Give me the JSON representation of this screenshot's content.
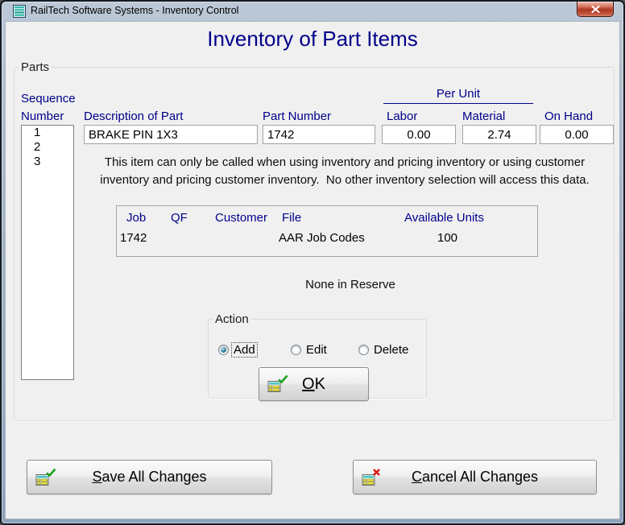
{
  "window": {
    "title": "RailTech Software Systems - Inventory Control"
  },
  "heading": "Inventory of Part Items",
  "parts": {
    "legend": "Parts",
    "labels": {
      "sequence": "Sequence",
      "number": "Number",
      "description": "Description of Part",
      "part_number": "Part Number",
      "per_unit": "Per Unit",
      "labor": "Labor",
      "material": "Material",
      "on_hand": "On Hand"
    },
    "sequence_list": [
      "1",
      "2",
      "3"
    ],
    "fields": {
      "description": "BRAKE PIN 1X3",
      "part_number": "1742",
      "labor": "0.00",
      "material": "2.74",
      "on_hand": "0.00"
    },
    "note_line1": "This item can only be called when using inventory and pricing inventory or using customer",
    "note_line2": "inventory and pricing customer inventory.  No other inventory selection will access this data.",
    "job_box": {
      "headers": {
        "job": "Job",
        "qf": "QF",
        "customer": "Customer",
        "file": "File",
        "available_units": "Available Units"
      },
      "values": {
        "job": "1742",
        "file": "AAR Job Codes",
        "available_units": "100"
      }
    },
    "reserve_text": "None in Reserve",
    "action": {
      "legend": "Action",
      "options": [
        {
          "label": "Add",
          "selected": true
        },
        {
          "label": "Edit",
          "selected": false
        },
        {
          "label": "Delete",
          "selected": false
        }
      ],
      "ok_label": "OK"
    }
  },
  "footer": {
    "save_label": "Save All Changes",
    "cancel_label": "Cancel All Changes"
  },
  "colors": {
    "accent": "#00008B",
    "check_green": "#1da11d",
    "cross_red": "#dd1111",
    "icon_teal": "#4fc3c3",
    "icon_yellow": "#f2e83b"
  }
}
